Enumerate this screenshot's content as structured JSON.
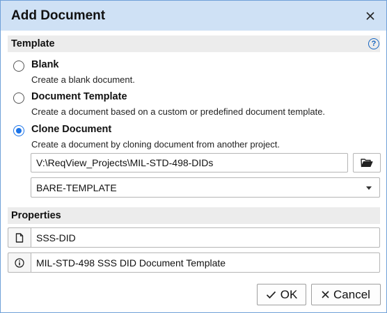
{
  "dialog": {
    "title": "Add Document"
  },
  "template_section": {
    "title": "Template",
    "help": "?",
    "options": [
      {
        "label": "Blank",
        "description": "Create a blank document.",
        "checked": false
      },
      {
        "label": "Document Template",
        "description": "Create a document based on a custom or predefined document template.",
        "checked": false
      },
      {
        "label": "Clone Document",
        "description": "Create a document by cloning document from another project.",
        "checked": true
      }
    ],
    "project_path": "V:\\ReqView_Projects\\MIL-STD-498-DIDs",
    "document_select": "BARE-TEMPLATE"
  },
  "properties_section": {
    "title": "Properties",
    "document_id": "SSS-DID",
    "document_name": "MIL-STD-498 SSS DID Document Template"
  },
  "footer": {
    "ok_label": "OK",
    "cancel_label": "Cancel"
  },
  "colors": {
    "accent": "#1a73e8",
    "titlebar": "#cfe1f5",
    "section_header": "#ececec"
  }
}
